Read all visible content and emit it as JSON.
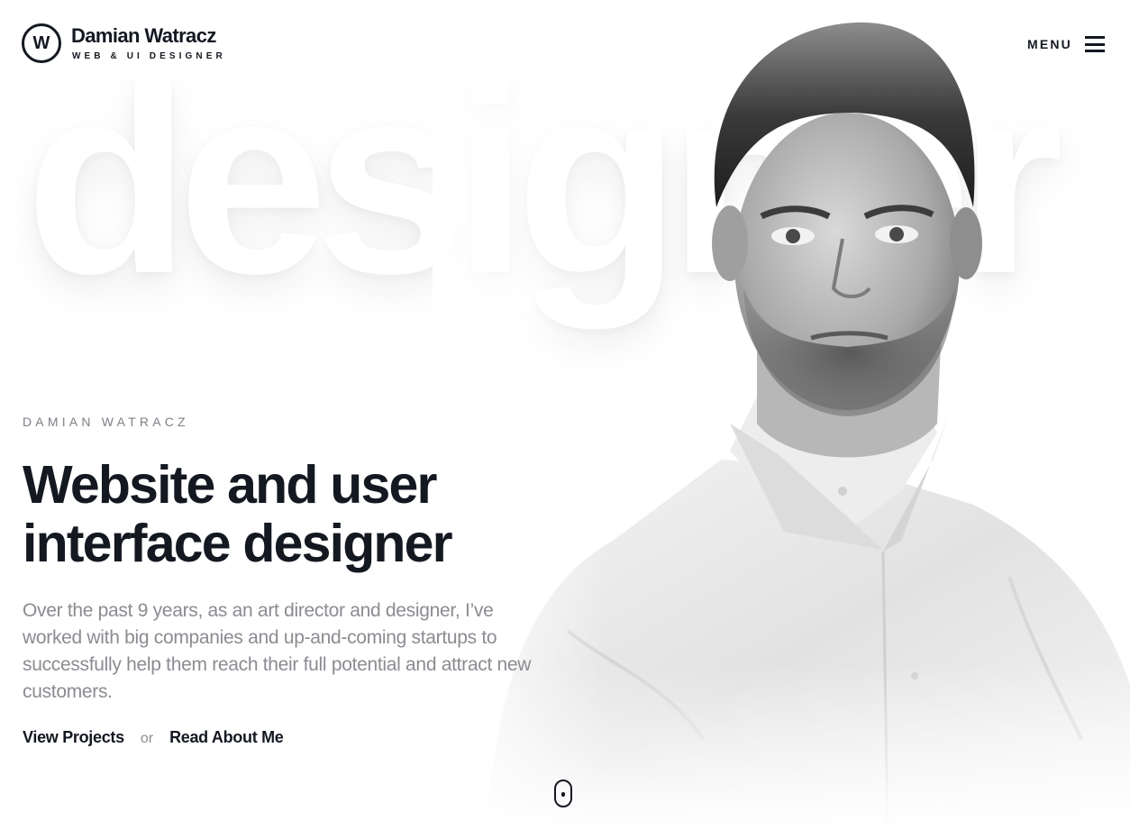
{
  "header": {
    "logo_letter": "W",
    "logo_name": "Damian Watracz",
    "logo_subtitle": "WEB & UI DESIGNER",
    "menu_label": "MENU"
  },
  "background_word": "designer",
  "hero": {
    "kicker": "DAMIAN WATRACZ",
    "headline_line1": "Website and user",
    "headline_line2": "interface designer",
    "intro": "Over the past 9 years, as an art director and designer, I’ve worked with big companies and up-and-coming startups to successfully help them reach their full potential and attract new customers.",
    "cta_primary": "View Projects",
    "cta_separator": "or",
    "cta_secondary": "Read About Me"
  },
  "icons": {
    "logo": "circle-w-logo-icon",
    "menu": "hamburger-icon",
    "scroll": "mouse-scroll-icon"
  },
  "colors": {
    "text_dark": "#141821",
    "text_muted": "#8a8c91",
    "background": "#ffffff"
  }
}
